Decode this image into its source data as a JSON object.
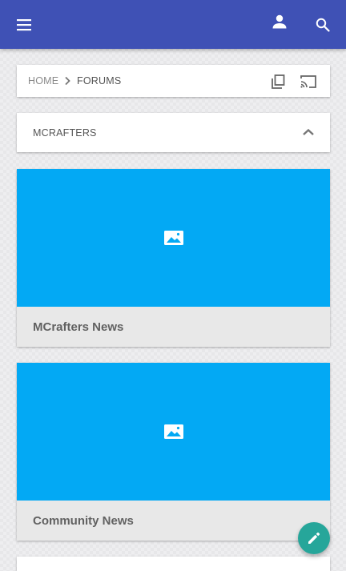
{
  "appbar": {
    "color": "#3f51b5",
    "icons": [
      "menu-icon",
      "account-icon",
      "search-icon"
    ]
  },
  "breadcrumb": {
    "home_label": "HOME",
    "current_label": "FORUMS",
    "separator_icon": "chevron-right-icon",
    "action_icons": [
      "copy-icon",
      "cast-icon"
    ]
  },
  "section": {
    "title": "MCRAFTERS",
    "toggle_icon": "chevron-up-icon"
  },
  "forums": [
    {
      "title": "MCrafters News",
      "image_icon": "image-icon",
      "color": "#03a9f4"
    },
    {
      "title": "Community News",
      "image_icon": "image-icon",
      "color": "#03a9f4"
    }
  ],
  "fab": {
    "icon": "pencil-icon",
    "color": "#26a69a"
  }
}
